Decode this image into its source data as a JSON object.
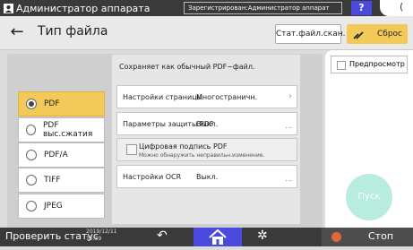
{
  "topbar": {
    "admin_label": "Администратор аппарата",
    "registered_text": "Зарегистрирован:Администратор аппарат",
    "help_label": "?",
    "corner_glyph": "("
  },
  "header": {
    "title": "Тип файла",
    "back_icon": "back-arrow-icon",
    "scan_file_label": "Стат.файл.скан.",
    "reset_label": "Сброс"
  },
  "file_types": {
    "selected": "PDF",
    "items": [
      "PDF",
      "PDF выс.сжатия",
      "PDF/A",
      "TIFF",
      "JPEG"
    ]
  },
  "settings": {
    "subtitle": "Сохраняет как обычный PDF−файл.",
    "page_settings": {
      "label": "Настройки страницы",
      "value": "Многостраничн."
    },
    "pdf_security": {
      "label": "Параметры защиты PDF",
      "value": "Выкл."
    },
    "digital_signature": {
      "label": "Цифровая подпись PDF",
      "note": "Можно обнаружить неправильн.изменение."
    },
    "ocr": {
      "label": "Настройки OCR",
      "value": "Выкл."
    },
    "dots": "..."
  },
  "right": {
    "preview_label": "Предпросмотр",
    "start_label": "Пуск"
  },
  "bottombar": {
    "status_label": "Проверить статус",
    "date": "2019/12/11",
    "time": "15:39",
    "stop_label": "Стоп"
  },
  "colors": {
    "accent_yellow": "#f3c95a",
    "nav_blue": "#4a4adf",
    "start_disabled": "#b7ecdf",
    "stop_orange": "#e2663a"
  }
}
